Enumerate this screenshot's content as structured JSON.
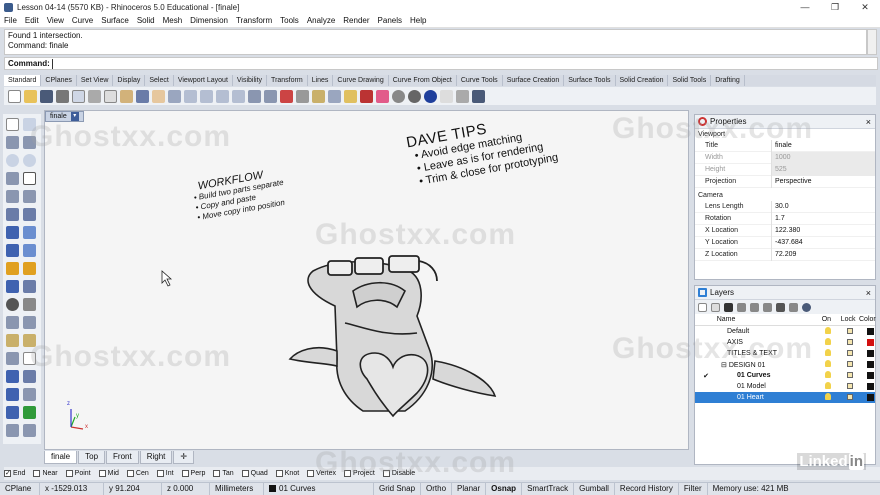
{
  "window": {
    "title": "Lesson 04-14 (5570 KB) - Rhinoceros 5.0 Educational - [finale]",
    "controls": [
      "—",
      "❐",
      "✕"
    ]
  },
  "menu": [
    "File",
    "Edit",
    "View",
    "Curve",
    "Surface",
    "Solid",
    "Mesh",
    "Dimension",
    "Transform",
    "Tools",
    "Analyze",
    "Render",
    "Panels",
    "Help"
  ],
  "command": {
    "history": [
      "Found 1 intersection.",
      "Command: finale"
    ],
    "prompt": "Command:",
    "value": ""
  },
  "toolbar_tabs": [
    "Standard",
    "CPlanes",
    "Set View",
    "Display",
    "Select",
    "Viewport Layout",
    "Visibility",
    "Transform",
    "Lines",
    "Curve Drawing",
    "Curve From Object",
    "Curve Tools",
    "Surface Creation",
    "Surface Tools",
    "Solid Creation",
    "Solid Tools",
    "Drafting"
  ],
  "toolbar_tabs_active": "Standard",
  "viewport": {
    "name": "finale",
    "dropdown": "▾",
    "tabs": [
      "finale",
      "Top",
      "Front",
      "Right",
      "✛"
    ],
    "active_tab": "finale",
    "dave_tips": {
      "title": "DAVE TIPS",
      "items": [
        "• Avoid edge matching",
        "• Leave as is for rendering",
        "• Trim & close for prototyping"
      ]
    },
    "workflow": {
      "title": "WORKFLOW",
      "items": [
        "• Build two parts separate",
        "• Copy and paste",
        "• Move copy into position"
      ]
    },
    "axis": {
      "x": "x",
      "y": "y",
      "z": "z"
    }
  },
  "osnaps": [
    {
      "label": "End",
      "checked": true
    },
    {
      "label": "Near",
      "checked": false
    },
    {
      "label": "Point",
      "checked": false
    },
    {
      "label": "Mid",
      "checked": false
    },
    {
      "label": "Cen",
      "checked": false
    },
    {
      "label": "Int",
      "checked": false
    },
    {
      "label": "Perp",
      "checked": false
    },
    {
      "label": "Tan",
      "checked": false
    },
    {
      "label": "Quad",
      "checked": false
    },
    {
      "label": "Knot",
      "checked": false
    },
    {
      "label": "Vertex",
      "checked": false
    },
    {
      "label": "Project",
      "checked": false
    },
    {
      "label": "Disable",
      "checked": false
    }
  ],
  "status": {
    "cplane": "CPlane",
    "x": "x -1529.013",
    "y": "y 91.204",
    "z": "z 0.000",
    "units": "Millimeters",
    "layer": "01 Curves",
    "grid_snap": "Grid Snap",
    "ortho": "Ortho",
    "planar": "Planar",
    "osnap": "Osnap",
    "smarttrack": "SmartTrack",
    "gumball": "Gumball",
    "record_history": "Record History",
    "filter": "Filter",
    "memory": "Memory use: 421 MB"
  },
  "properties": {
    "header": "Properties",
    "section_viewport": "Viewport",
    "section_camera": "Camera",
    "viewport_rows": [
      {
        "key": "Title",
        "value": "finale",
        "disabled": false
      },
      {
        "key": "Width",
        "value": "1000",
        "disabled": true
      },
      {
        "key": "Height",
        "value": "525",
        "disabled": true
      },
      {
        "key": "Projection",
        "value": "Perspective",
        "disabled": false
      }
    ],
    "camera_rows": [
      {
        "key": "Lens Length",
        "value": "30.0"
      },
      {
        "key": "Rotation",
        "value": "1.7"
      },
      {
        "key": "X Location",
        "value": "122.380"
      },
      {
        "key": "Y Location",
        "value": "-437.684"
      },
      {
        "key": "Z Location",
        "value": "72.209"
      }
    ]
  },
  "layers": {
    "header": "Layers",
    "columns": {
      "name": "Name",
      "on": "On",
      "lock": "Lock",
      "color": "Color"
    },
    "rows": [
      {
        "name": "Default",
        "indent": 0,
        "color": "#111111",
        "current": false,
        "selected": false,
        "bold": false
      },
      {
        "name": "AXIS",
        "indent": 0,
        "color": "#d21010",
        "current": false,
        "selected": false,
        "bold": false
      },
      {
        "name": "TITLES & TEXT",
        "indent": 0,
        "color": "#111111",
        "current": false,
        "selected": false,
        "bold": false
      },
      {
        "name": "DESIGN 01",
        "indent": 0,
        "color": "#111111",
        "current": false,
        "selected": false,
        "bold": false
      },
      {
        "name": "01 Curves",
        "indent": 1,
        "color": "#111111",
        "current": true,
        "selected": false,
        "bold": true
      },
      {
        "name": "01 Model",
        "indent": 1,
        "color": "#111111",
        "current": false,
        "selected": false,
        "bold": false
      },
      {
        "name": "01 Heart",
        "indent": 1,
        "color": "#111111",
        "current": false,
        "selected": true,
        "bold": false
      }
    ]
  },
  "branding": {
    "linkedin": "Linked",
    "in": "in"
  },
  "watermark": "Ghostxx.com"
}
